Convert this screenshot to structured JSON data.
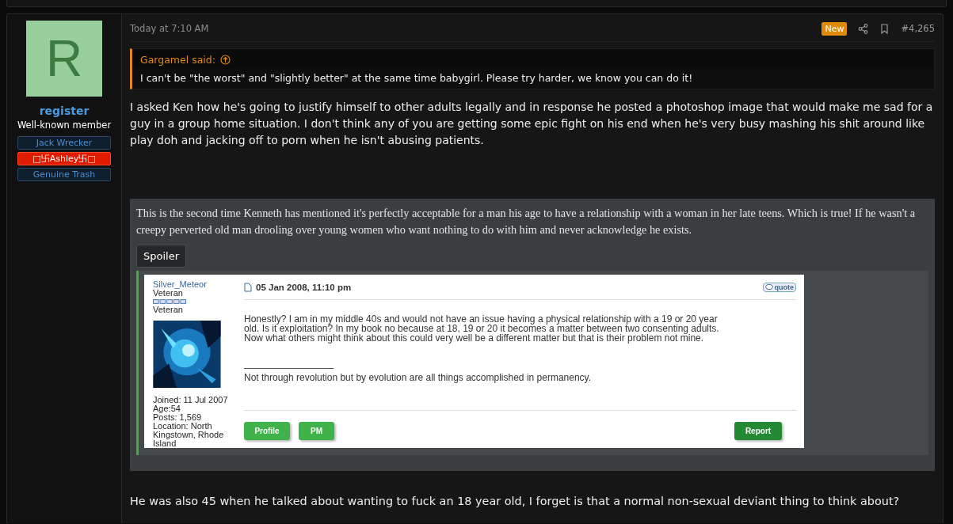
{
  "post": {
    "author": {
      "avatar_letter": "R",
      "username": "register",
      "user_title": "Well-known member",
      "banners": [
        {
          "text": "Jack Wrecker",
          "kind": "dark"
        },
        {
          "text": "□卐Ashley卐□",
          "kind": "red"
        },
        {
          "text": "Genuine Trash",
          "kind": "dark"
        }
      ]
    },
    "time": "Today at 7:10 AM",
    "new_label": "New",
    "post_number": "#4,265",
    "quote": {
      "author": "Gargamel said:",
      "text": "I can't be \"the worst\" and \"slightly better\" at the same time babygirl. Please try harder, we know you can do it!"
    },
    "body": "I asked Ken how he's going to justify himself to other adults legally and in response he posted a photoshop image that would make me sad for a guy in a group home situation. I don't think any of you are getting some epic fight on his end when he's very busy mashing his shit around like play doh and jacking off to porn when he isn't abusing patients.",
    "quoted_block": {
      "text": "This is the second time Kenneth has mentioned it's perfectly acceptable for a man his age to have a relationship with a woman in her late teens. Which is true! If he wasn't a creepy perverted old man drooling over young women who want nothing to do with him and never acknowledge he exists.",
      "spoiler_button": "Spoiler",
      "embedded_post": {
        "username": "Silver_Meteor",
        "rank": "Veteran",
        "rank_label": "Veteran",
        "details": [
          "Joined: 11 Jul 2007",
          "Age:54",
          "Posts: 1,569",
          "Location: North Kingstown, Rhode Island"
        ],
        "date": "05 Jan 2008, 11:10 pm",
        "quote_button": "quote",
        "text": "Honestly? I am in my middle 40s and would not have an issue having a physical relationship with a 19 or 20 year old. Is it exploitation? In my book no because at 18, 19 or 20 it becomes a matter between two consenting adults. Now what others might think about this could very well be a different matter but that is their problem not mine.",
        "signature": "Not through revolution but by evolution are all things accomplished in permanency.",
        "buttons": [
          {
            "label": "Profile",
            "kind": "left"
          },
          {
            "label": "PM",
            "kind": "left"
          },
          {
            "label": "Report",
            "kind": "right"
          }
        ]
      }
    },
    "closing": "He was also 45 when he talked about wanting to fuck an 18 year old, I forget is that a normal non-sexual deviant thing to think about?"
  }
}
